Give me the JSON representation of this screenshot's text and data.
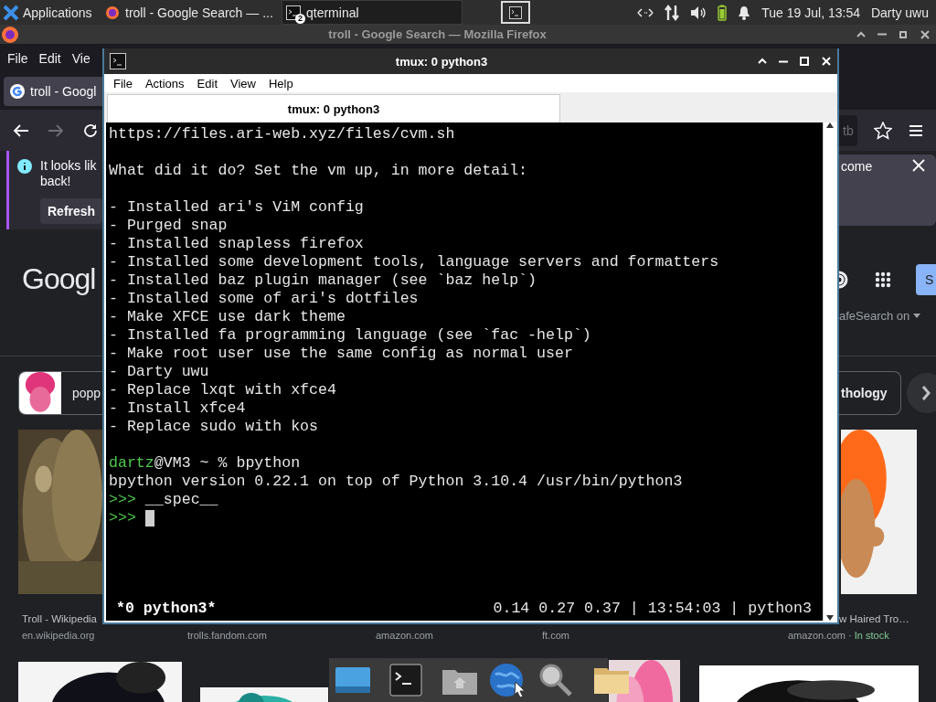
{
  "panel": {
    "apps_label": "Applications",
    "tasks": [
      {
        "kind": "browser",
        "label": "troll - Google Search — ...",
        "selected": false
      },
      {
        "kind": "terminal",
        "label": "qterminal",
        "badge": "2",
        "selected": true
      }
    ],
    "clock": "Tue 19 Jul, 13:54",
    "user": "Darty uwu"
  },
  "firefox": {
    "title": "troll - Google Search — Mozilla Firefox",
    "menu": [
      "File",
      "Edit",
      "Vie"
    ],
    "tab": "troll - Googl",
    "forward_disabled": true,
    "url_fragment": "tb",
    "notice": {
      "line_1": "It looks lik",
      "line_2": "back!",
      "button": "Refresh",
      "right_text": "come"
    },
    "logo": "Googl",
    "sign_in": "S",
    "safesearch": "afeSearch on",
    "chips": [
      "popp",
      "thology"
    ],
    "results": [
      {
        "title": "Troll - Wikipedia",
        "source": "en.wikipedia.org"
      },
      {
        "source": "trolls.fandom.com"
      },
      {
        "source": "amazon.com"
      },
      {
        "source": "ft.com"
      },
      {
        "title": "w Haired Tro…",
        "source": "amazon.com",
        "separator": "·",
        "stock": "In stock"
      }
    ]
  },
  "terminal": {
    "title": "tmux: 0 python3",
    "menu": [
      "File",
      "Actions",
      "Edit",
      "View",
      "Help"
    ],
    "tab": {
      "label": "tmux: 0 python3",
      "selected": true
    },
    "lines": [
      {
        "kind": "text",
        "text": "https://files.ari-web.xyz/files/cvm.sh"
      },
      {
        "kind": "blank"
      },
      {
        "kind": "text",
        "text": "What did it do? Set the vm up, in more detail:"
      },
      {
        "kind": "blank"
      },
      {
        "kind": "text",
        "text": "- Installed ari's ViM config"
      },
      {
        "kind": "text",
        "text": "- Purged snap"
      },
      {
        "kind": "text",
        "text": "- Installed snapless firefox"
      },
      {
        "kind": "text",
        "text": "- Installed some development tools, language servers and formatters"
      },
      {
        "kind": "text",
        "text": "- Installed baz plugin manager (see `baz help`)"
      },
      {
        "kind": "text",
        "text": "- Installed some of ari's dotfiles"
      },
      {
        "kind": "text",
        "text": "- Make XFCE use dark theme"
      },
      {
        "kind": "text",
        "text": "- Installed fa programming language (see `fac -help`)"
      },
      {
        "kind": "text",
        "text": "- Make root user use the same config as normal user"
      },
      {
        "kind": "text",
        "text": "- Darty uwu"
      },
      {
        "kind": "text",
        "text": "- Replace lxqt with xfce4"
      },
      {
        "kind": "text",
        "text": "- Install xfce4"
      },
      {
        "kind": "text",
        "text": "- Replace sudo with kos"
      },
      {
        "kind": "blank"
      },
      {
        "kind": "shell",
        "user": "dartz",
        "rest": "@VM3 ~ % bpython"
      },
      {
        "kind": "text",
        "text": "bpython version 0.22.1 on top of Python 3.10.4 /usr/bin/python3"
      },
      {
        "kind": "repl",
        "prompt": ">>>",
        "text": "__spec__"
      },
      {
        "kind": "repl",
        "prompt": ">>>",
        "cursor": true
      }
    ],
    "status_left": "*0 python3*",
    "status_right": "0.14 0.27 0.37 | 13:54:03 | python3"
  },
  "dock": [
    {
      "kind": "desktop"
    },
    {
      "kind": "terminal"
    },
    {
      "kind": "home"
    },
    {
      "kind": "globe"
    },
    {
      "kind": "search"
    },
    {
      "kind": "folder"
    }
  ]
}
